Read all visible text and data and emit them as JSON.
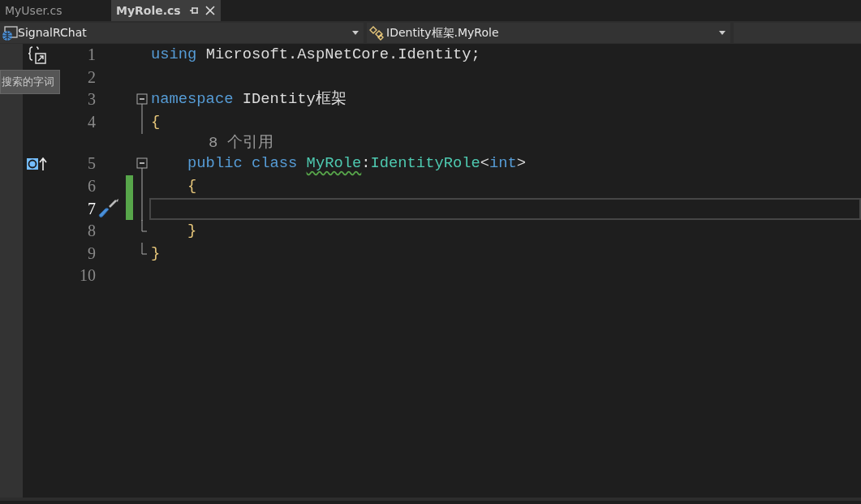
{
  "tabs": [
    {
      "label": "MyUser.cs",
      "selected": false
    },
    {
      "label": "MyRole.cs",
      "selected": true
    }
  ],
  "nav_bar": {
    "project": "SignalRChat",
    "member": "IDentity框架.MyRole"
  },
  "search_hint": "搜索的字词",
  "editor": {
    "lines": [
      {
        "number": "1",
        "current": false,
        "changed": false,
        "glyph": {
          "kind": "snippet"
        },
        "tokens": [
          {
            "kind": "keyword",
            "text": "using"
          },
          {
            "kind": "plain",
            "text": " Microsoft.AspNetCore.Identity;"
          }
        ]
      },
      {
        "number": "2",
        "current": false,
        "changed": false
      },
      {
        "number": "3",
        "current": false,
        "changed": false,
        "outline": {
          "kind": "open"
        },
        "tokens": [
          {
            "kind": "keyword",
            "text": "namespace"
          },
          {
            "kind": "plain",
            "text": " IDentity框架"
          }
        ]
      },
      {
        "number": "4",
        "current": false,
        "changed": false,
        "outline": {
          "kind": "bar"
        },
        "tokens": [
          {
            "kind": "brace",
            "text": "{"
          }
        ]
      },
      {
        "number": "5",
        "current": false,
        "changed": false,
        "glyph": {
          "kind": "implements"
        },
        "outline": {
          "kind": "open"
        },
        "codelens": "8 个引用",
        "tokens": [
          {
            "kind": "keyword",
            "text": "    public class "
          },
          {
            "kind": "type",
            "text": "MyRole",
            "squiggle": true
          },
          {
            "kind": "plain",
            "text": ":"
          },
          {
            "kind": "type",
            "text": "IdentityRole"
          },
          {
            "kind": "plain",
            "text": "<"
          },
          {
            "kind": "keyword",
            "text": "int"
          },
          {
            "kind": "plain",
            "text": ">"
          }
        ]
      },
      {
        "number": "6",
        "current": false,
        "changed": true,
        "outline": {
          "kind": "bar"
        },
        "tokens": [
          {
            "kind": "brace",
            "text": "    {"
          }
        ]
      },
      {
        "number": "7",
        "current": true,
        "changed": true,
        "glyph": {
          "kind": "quick-action"
        },
        "outline": {
          "kind": "bar"
        }
      },
      {
        "number": "8",
        "current": false,
        "changed": false,
        "outline": {
          "kind": "end"
        },
        "tokens": [
          {
            "kind": "brace",
            "text": "    }"
          }
        ]
      },
      {
        "number": "9",
        "current": false,
        "changed": false,
        "outline": {
          "kind": "end"
        },
        "tokens": [
          {
            "kind": "brace",
            "text": "}"
          }
        ]
      },
      {
        "number": "10",
        "current": false,
        "changed": false
      }
    ]
  }
}
